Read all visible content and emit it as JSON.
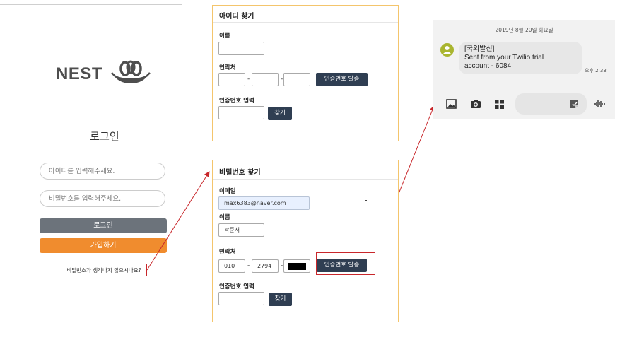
{
  "login": {
    "logo_text": "NEST",
    "title": "로그인",
    "id_placeholder": "아이디를 입력해주세요.",
    "pw_placeholder": "비밀번호를 입력해주세요.",
    "login_button": "로그인",
    "join_button": "가입하기",
    "forgot_link": "비밀번호가 생각나지 않으시나요?"
  },
  "find_id": {
    "title": "아이디 찾기",
    "name_label": "이름",
    "name_value": "",
    "phone_label": "연락처",
    "phone1": "",
    "phone2": "",
    "phone3": "",
    "dash": "-",
    "send_button": "인증번호 발송",
    "code_label": "인증번호 입력",
    "code_value": "",
    "find_button": "찾기"
  },
  "find_pw": {
    "title": "비밀번호 찾기",
    "email_label": "이메일",
    "email_value": "max6383@naver.com",
    "name_label": "이름",
    "name_value": "곽준서",
    "phone_label": "연락처",
    "phone1": "010",
    "phone2": "2794",
    "phone3": "",
    "dash": "-",
    "send_button": "인증번호 발송",
    "code_label": "인증번호 입력",
    "code_value": "",
    "find_button": "찾기"
  },
  "sms": {
    "date": "2019년 8월 20일 화요일",
    "line1": "[국외발신]",
    "line2": "Sent from your Twilio trial",
    "line3": "account - 6084",
    "time": "오후 2:33",
    "toolbar_icons": [
      "gallery-icon",
      "camera-icon",
      "apps-icon",
      "sticker-icon",
      "voice-icon"
    ]
  },
  "colors": {
    "card_border": "#f4c56c",
    "dark_button": "#2f3e52",
    "login_button": "#6c737b",
    "join_button": "#f08c2e",
    "annotation": "#c8272b",
    "avatar": "#a9b52f"
  }
}
